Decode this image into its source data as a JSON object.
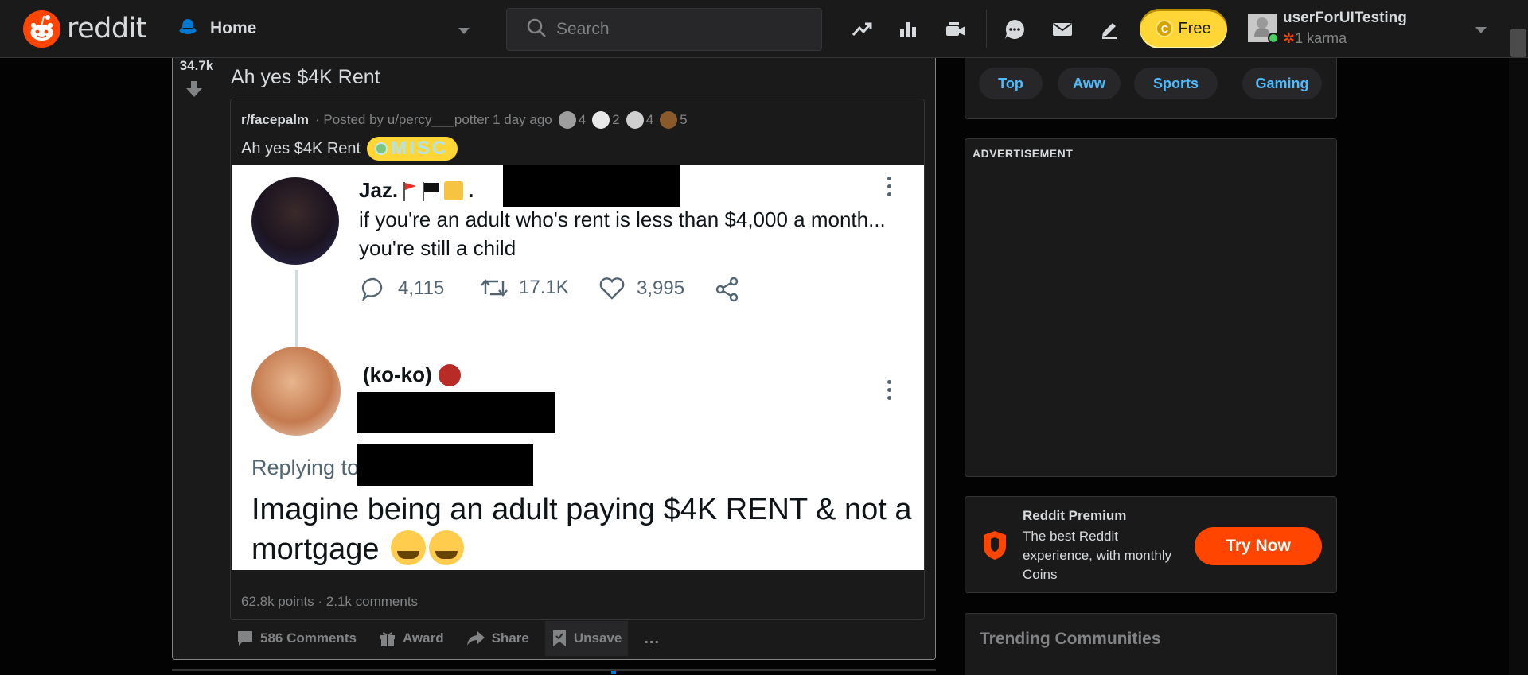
{
  "header": {
    "logo_text": "reddit",
    "home_label": "Home",
    "search_placeholder": "Search",
    "free_label": "Free",
    "coin_glyph": "C",
    "username": "userForUITesting",
    "karma": "1 karma",
    "icons": [
      "popular-icon",
      "statistics-icon",
      "rpan-icon",
      "chat-icon",
      "mail-icon",
      "create-post-icon"
    ]
  },
  "post": {
    "score": "34.7k",
    "title": "Ah yes $4K Rent",
    "crosspost": {
      "subreddit": "r/facepalm",
      "meta": "· Posted by u/percy___potter 1 day ago",
      "awards": [
        {
          "icon": "award-1-icon",
          "count": "4"
        },
        {
          "icon": "award-2-icon",
          "count": "2"
        },
        {
          "icon": "award-3-icon",
          "count": "4"
        },
        {
          "icon": "award-4-icon",
          "count": "5"
        }
      ],
      "title": "Ah yes $4K Rent",
      "flair": "MISC",
      "stats": "62.8k points · 2.1k comments"
    },
    "tweet": {
      "name1": "Jaz.",
      "text1": "if you're an adult who's rent is less than $4,000 a month... you're still a child",
      "replies": "4,115",
      "retweets": "17.1K",
      "likes": "3,995",
      "name2": "(ko-ko)",
      "replying": "Replying to",
      "text2": "Imagine being an adult paying $4K RENT & not a mortgage"
    },
    "actions": {
      "comments": "586 Comments",
      "award": "Award",
      "share": "Share",
      "unsave": "Unsave",
      "more": "..."
    }
  },
  "sidebar": {
    "pills": [
      "Top",
      "Aww",
      "Sports",
      "Gaming"
    ],
    "ad_label": "ADVERTISEMENT",
    "premium": {
      "title": "Reddit Premium",
      "desc": "The best Reddit experience, with monthly Coins",
      "button": "Try Now"
    },
    "trending_title": "Trending Communities"
  },
  "colors": {
    "accent": "#ff4500",
    "link": "#4fbcff",
    "gold": "#ffd635",
    "background": "#030303",
    "card": "#1a1a1b"
  }
}
